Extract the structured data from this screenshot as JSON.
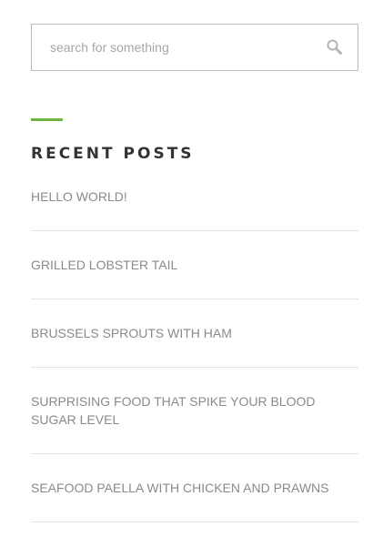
{
  "search": {
    "placeholder": "search for something",
    "value": "",
    "icon": "search-icon"
  },
  "recent_posts": {
    "title": "RECENT POSTS",
    "accent_color": "#6fb43f",
    "items": [
      {
        "label": "HELLO WORLD!"
      },
      {
        "label": "GRILLED LOBSTER TAIL"
      },
      {
        "label": "BRUSSELS SPROUTS WITH HAM"
      },
      {
        "label": "SURPRISING FOOD THAT SPIKE YOUR BLOOD SUGAR LEVEL"
      },
      {
        "label": "SEAFOOD PAELLA WITH CHICKEN AND PRAWNS"
      }
    ]
  }
}
